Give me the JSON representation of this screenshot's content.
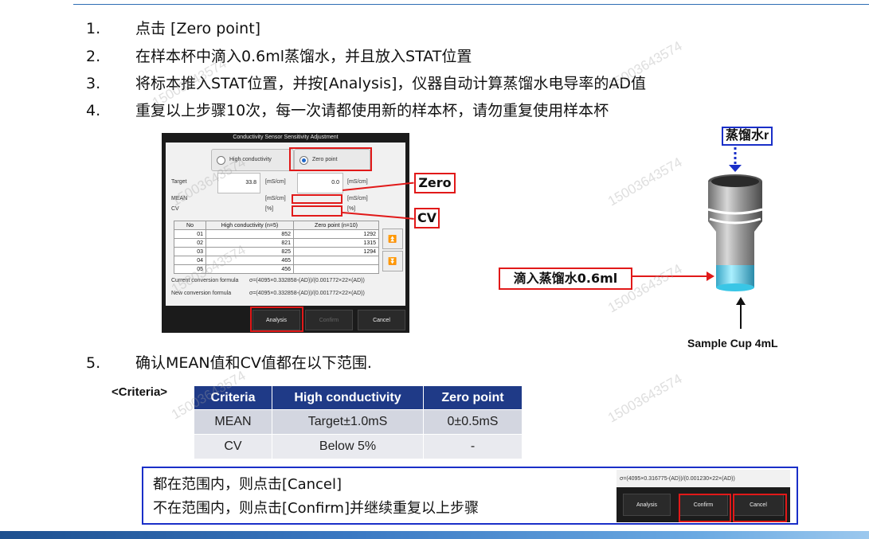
{
  "steps": [
    {
      "num": "1.",
      "text": "点击 [Zero point]"
    },
    {
      "num": "2.",
      "text": "在样本杯中滴入0.6ml蒸馏水，并且放入STAT位置"
    },
    {
      "num": "3.",
      "text": "将标本推入STAT位置，并按[Analysis]，仪器自动计算蒸馏水电导率的AD值"
    },
    {
      "num": "4.",
      "text": "重复以上步骤10次，每一次请都使用新的样本杯，请勿重复使用样本杯"
    },
    {
      "num": "5.",
      "text": "确认MEAN值和CV值都在以下范围."
    }
  ],
  "dialog": {
    "title": "Conductivity Sensor Sensitivity Adjustment",
    "radio_high": "High conductivity",
    "radio_zero": "Zero point",
    "target_label": "Target",
    "target_high": "33.8",
    "target_zero": "0.0",
    "unit_mscm": "[mS/cm]",
    "mean_label": "MEAN",
    "cv_label": "CV",
    "unit_pct": "[%]",
    "table_headers": [
      "No",
      "High conductivity (n=5)",
      "Zero point (n=10)"
    ],
    "table_rows": [
      [
        "01",
        "852",
        "1292"
      ],
      [
        "02",
        "821",
        "1315"
      ],
      [
        "03",
        "825",
        "1294"
      ],
      [
        "04",
        "465",
        ""
      ],
      [
        "05",
        "456",
        ""
      ]
    ],
    "current_formula_label": "Current conversion formula",
    "current_formula": "σ=(4095×0.332858-(AD))/(0.001772×22×(AD))",
    "new_formula_label": "New conversion formula",
    "new_formula": "σ=(4095×0.332858-(AD))/(0.001772×22×(AD))",
    "btn_analysis": "Analysis",
    "btn_confirm": "Confirm",
    "btn_cancel": "Cancel"
  },
  "callouts": {
    "zero": "Zero",
    "cv": "CV",
    "distilled_water": "蒸馏水r",
    "drop_water": "滴入蒸馏水0.6ml",
    "sample_cup": "Sample Cup 4mL"
  },
  "criteria": {
    "tag": "<Criteria>",
    "headers": [
      "Criteria",
      "High conductivity",
      "Zero point"
    ],
    "rows": [
      [
        "MEAN",
        "Target±1.0mS",
        "0±0.5mS"
      ],
      [
        "CV",
        "Below 5%",
        "-"
      ]
    ]
  },
  "note": {
    "line1": "都在范围内，则点击[Cancel]",
    "line2": "不在范围内，则点击[Confirm]并继续重复以上步骤",
    "mini_formula": "σ=(4095×0.316775-(AD))/(0.001230×22×(AD))",
    "mini_analysis": "Analysis",
    "mini_confirm": "Confirm",
    "mini_cancel": "Cancel"
  },
  "watermark": "15003643574",
  "colors": {
    "accent_red": "#e11919",
    "header_blue": "#1f3a87",
    "note_border": "#1a2fc8",
    "cup_cyan": "#39c6e6"
  }
}
